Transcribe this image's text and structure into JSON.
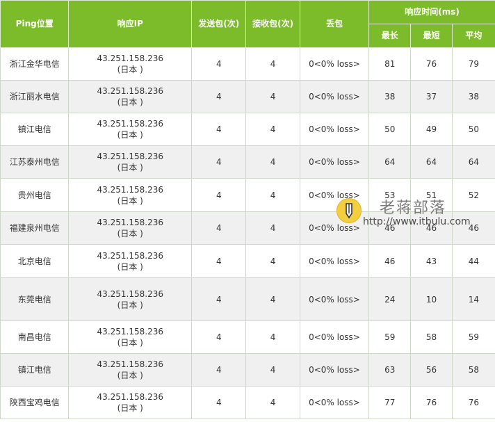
{
  "headers": {
    "location": "Ping位置",
    "ip": "响应IP",
    "sent": "发送包(次)",
    "received": "接收包(次)",
    "loss": "丢包",
    "time": "响应时间(ms)",
    "max": "最长",
    "min": "最短",
    "avg": "平均"
  },
  "rows": [
    {
      "location": "浙江金华电信",
      "ip": "43.251.158.236",
      "region": "(日本 )",
      "sent": "4",
      "received": "4",
      "loss": "0<0% loss>",
      "max": "81",
      "min": "76",
      "avg": "79"
    },
    {
      "location": "浙江丽水电信",
      "ip": "43.251.158.236",
      "region": "(日本 )",
      "sent": "4",
      "received": "4",
      "loss": "0<0% loss>",
      "max": "38",
      "min": "37",
      "avg": "38"
    },
    {
      "location": "镇江电信",
      "ip": "43.251.158.236",
      "region": "(日本 )",
      "sent": "4",
      "received": "4",
      "loss": "0<0% loss>",
      "max": "50",
      "min": "49",
      "avg": "50"
    },
    {
      "location": "江苏泰州电信",
      "ip": "43.251.158.236",
      "region": "(日本 )",
      "sent": "4",
      "received": "4",
      "loss": "0<0% loss>",
      "max": "64",
      "min": "64",
      "avg": "64"
    },
    {
      "location": "贵州电信",
      "ip": "43.251.158.236",
      "region": "(日本 )",
      "sent": "4",
      "received": "4",
      "loss": "0<0% loss>",
      "max": "53",
      "min": "51",
      "avg": "52"
    },
    {
      "location": "福建泉州电信",
      "ip": "43.251.158.236",
      "region": "(日本 )",
      "sent": "4",
      "received": "4",
      "loss": "0<0% loss>",
      "max": "46",
      "min": "46",
      "avg": "46"
    },
    {
      "location": "北京电信",
      "ip": "43.251.158.236",
      "region": "(日本 )",
      "sent": "4",
      "received": "4",
      "loss": "0<0% loss>",
      "max": "46",
      "min": "43",
      "avg": "44"
    },
    {
      "location": "东莞电信",
      "ip": "43.251.158.236",
      "region": "(日本 )",
      "sent": "4",
      "received": "4",
      "loss": "0<0% loss>",
      "max": "24",
      "min": "10",
      "avg": "14"
    },
    {
      "location": "南昌电信",
      "ip": "43.251.158.236",
      "region": "(日本 )",
      "sent": "4",
      "received": "4",
      "loss": "0<0% loss>",
      "max": "59",
      "min": "58",
      "avg": "59"
    },
    {
      "location": "镇江电信",
      "ip": "43.251.158.236",
      "region": "(日本 )",
      "sent": "4",
      "received": "4",
      "loss": "0<0% loss>",
      "max": "63",
      "min": "56",
      "avg": "58"
    },
    {
      "location": "陕西宝鸡电信",
      "ip": "43.251.158.236",
      "region": "(日本 )",
      "sent": "4",
      "received": "4",
      "loss": "0<0% loss>",
      "max": "77",
      "min": "76",
      "avg": "76"
    }
  ],
  "watermark": {
    "name": "老蒋部落",
    "url": "http://www.itbulu.com",
    "icon": "pencil-icon"
  },
  "colors": {
    "header_bg": "#7cbb2a",
    "stripe_bg": "#f0f0f0"
  }
}
